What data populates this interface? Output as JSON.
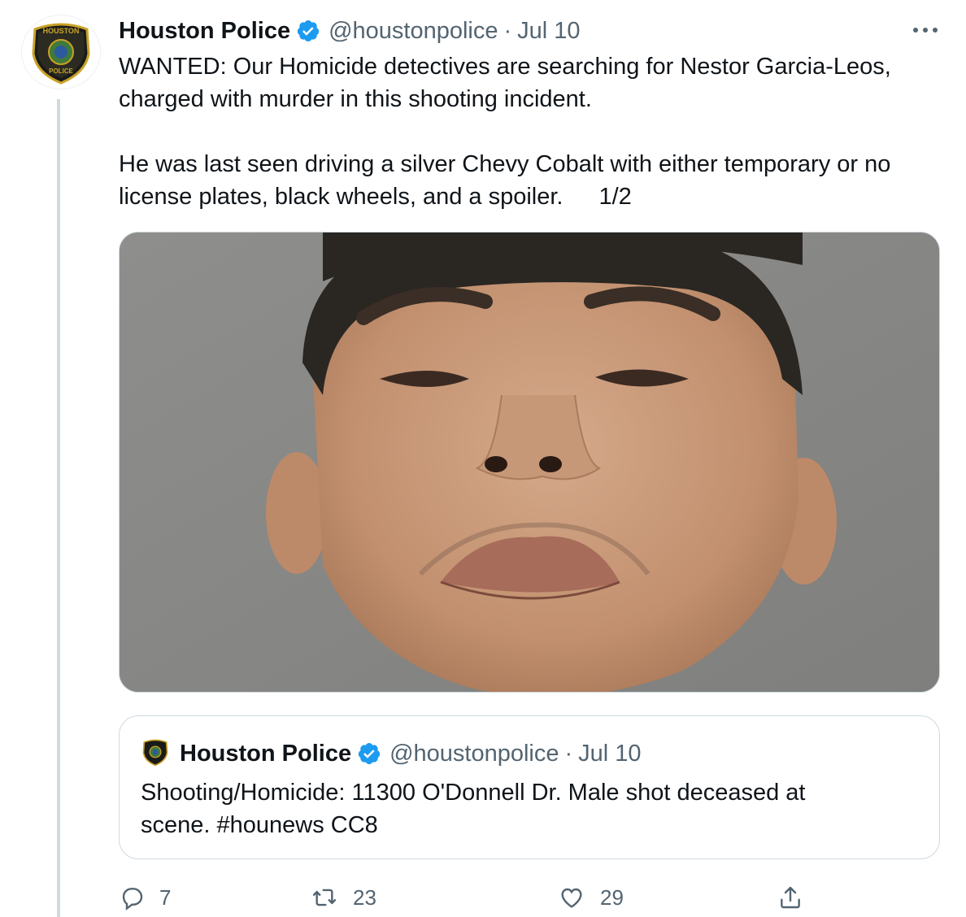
{
  "tweet": {
    "author_name": "Houston Police",
    "handle": "@houstonpolice",
    "separator": "·",
    "date": "Jul 10",
    "more_label": "•••",
    "text_line1": "WANTED: Our Homicide detectives are searching for Nestor Garcia-Leos,",
    "text_line2": "charged with murder in this shooting incident.",
    "text_line3": "He was last seen driving a silver Chevy Cobalt with either temporary or no",
    "text_line4": "license plates, black wheels, and a spoiler.",
    "thread_count": "1/2"
  },
  "avatar": {
    "badge_top": "HOUSTON",
    "badge_bottom": "POLICE"
  },
  "quote": {
    "author_name": "Houston Police",
    "handle": "@houstonpolice",
    "separator": "·",
    "date": "Jul 10",
    "text_line1": "Shooting/Homicide: 11300 O'Donnell Dr. Male shot deceased at",
    "text_line2": "scene. #hounews CC8"
  },
  "actions": {
    "replies": "7",
    "retweets": "23",
    "likes": "29"
  },
  "colors": {
    "verified": "#1d9bf0",
    "muted": "#536471",
    "border": "#cfd9de",
    "thread_line": "#cfd9de"
  },
  "icons": [
    "verified-badge-icon",
    "more-icon",
    "reply-icon",
    "retweet-icon",
    "like-icon",
    "share-icon"
  ]
}
